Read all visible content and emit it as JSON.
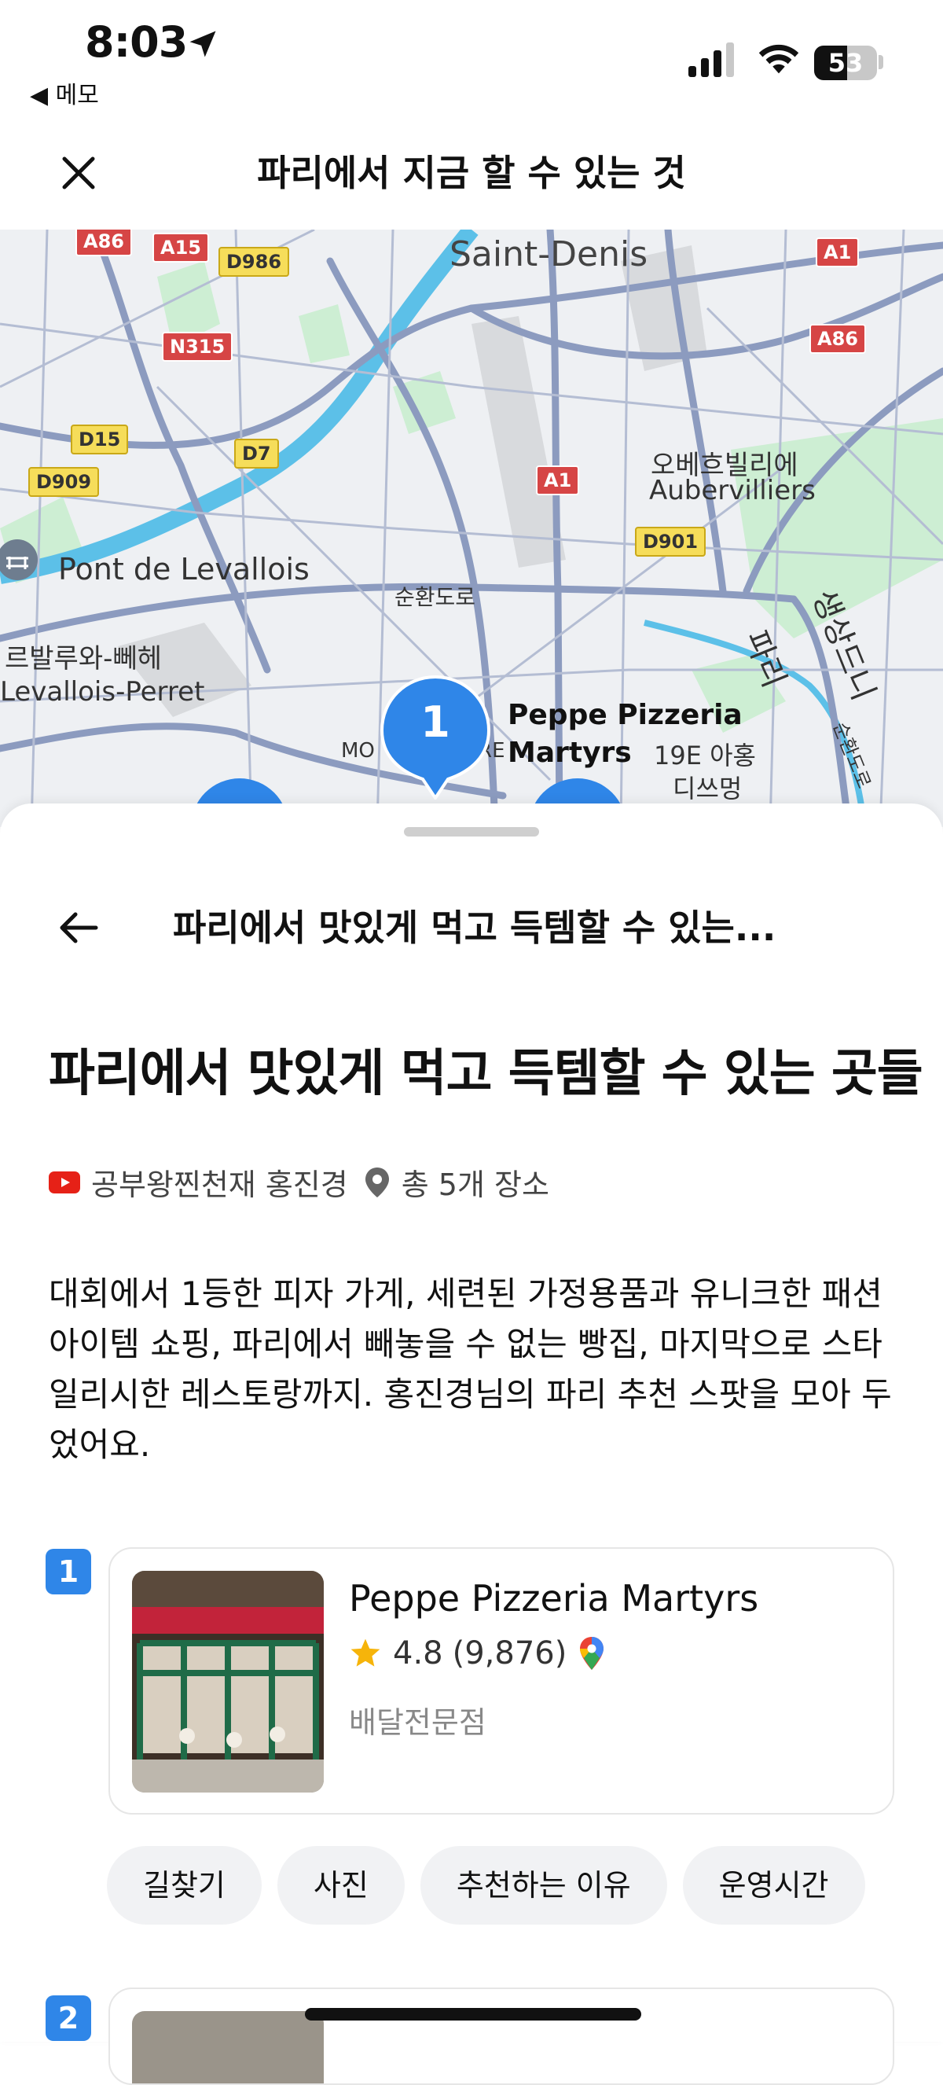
{
  "status_bar": {
    "time": "8:03",
    "back_app": "◀ 메모",
    "battery": "53"
  },
  "header": {
    "title": "파리에서 지금 할 수 있는 것"
  },
  "map": {
    "labels": {
      "saint_denis": "Saint-Denis",
      "aubervilliers_ko": "오베흐빌리에",
      "aubervilliers": "Aubervilliers",
      "pont_levallois": "Pont de Levallois",
      "levallois_ko": "르발루와-뻬헤",
      "levallois": "Levallois-Perret",
      "ring_road": "순환도로",
      "paris_vertical": "파리",
      "saint_denis_vertical": "생상드니",
      "ring_road_vertical": "순환도로",
      "arr19_line1": "19E 아홍",
      "arr19_line2": "디쓰멍",
      "mo_partial": "MO",
      "re_partial": "RE"
    },
    "shields": [
      "A86",
      "A15",
      "D986",
      "A1",
      "A86",
      "N315",
      "D15",
      "D7",
      "D909",
      "A1",
      "D901"
    ],
    "pin": {
      "number": "1",
      "label_line1": "Peppe Pizzeria",
      "label_line2": "Martyrs"
    }
  },
  "sheet": {
    "header_title": "파리에서 맛있게 먹고 득템할 수 있는...",
    "title": "파리에서 맛있게 먹고 득템할 수 있는 곳들",
    "author": "공부왕찐천재 홍진경",
    "place_count": "총 5개 장소",
    "description": "대회에서 1등한 피자 가게, 세련된 가정용품과 유니크한 패션 아이템 쇼핑, 파리에서 빼놓을 수 없는 빵집, 마지막으로 스타일리시한 레스토랑까지. 홍진경님의 파리 추천 스팟을 모아 두었어요.",
    "places": [
      {
        "number": "1",
        "name": "Peppe Pizzeria Martyrs",
        "rating": "4.8",
        "reviews": "(9,876)",
        "category": "배달전문점",
        "actions": [
          "길찾기",
          "사진",
          "추천하는 이유",
          "운영시간"
        ]
      },
      {
        "number": "2"
      }
    ]
  },
  "colors": {
    "accent": "#2f86e8",
    "map_road": "#8c9bbf",
    "map_water": "#5cc0e8",
    "map_park": "#cdeed3"
  }
}
